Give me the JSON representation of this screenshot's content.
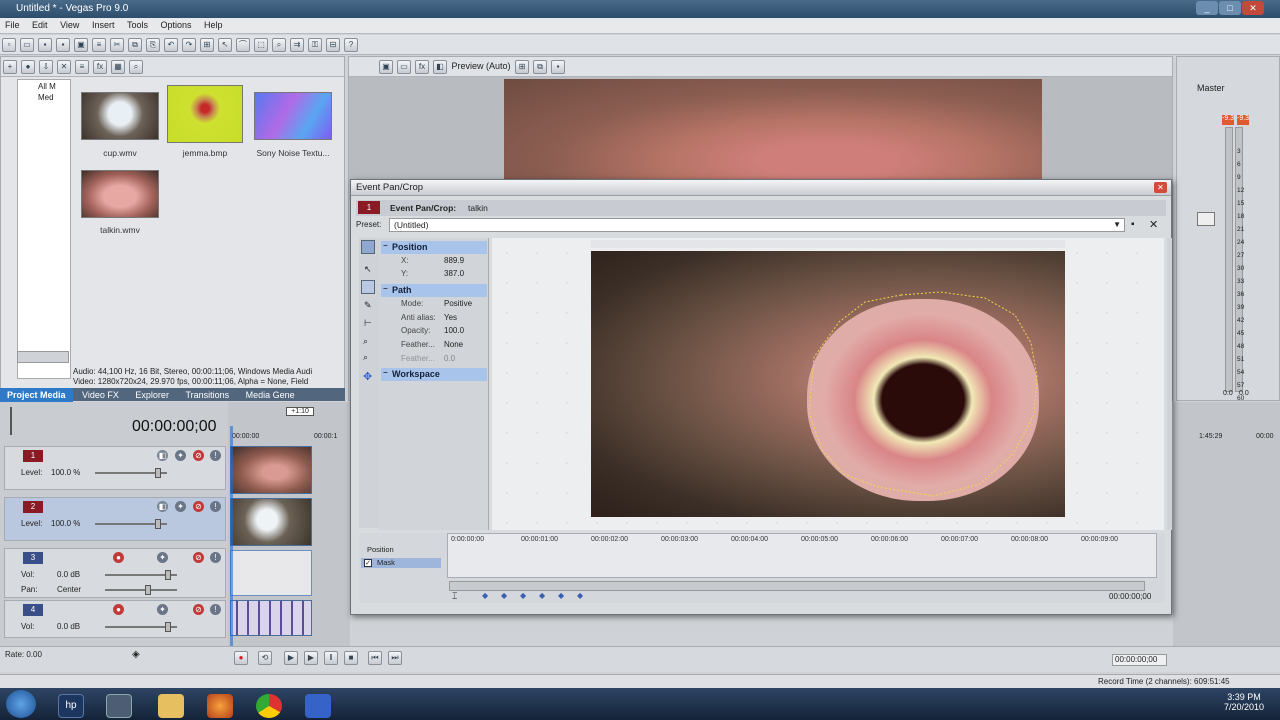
{
  "window": {
    "title": "Untitled * - Vegas Pro 9.0"
  },
  "menu": [
    "File",
    "Edit",
    "View",
    "Insert",
    "Tools",
    "Options",
    "Help"
  ],
  "project_media": {
    "tree": [
      "All M",
      "Med"
    ],
    "items": [
      {
        "label": "cup.wmv"
      },
      {
        "label": "jemma.bmp"
      },
      {
        "label": "Sony Noise Textu..."
      },
      {
        "label": "talkin.wmv"
      }
    ],
    "info_line1": "Audio: 44,100 Hz, 16 Bit, Stereo, 00:00:11;06, Windows Media Audi",
    "info_line2": "Video: 1280x720x24, 29.970 fps, 00:00:11;06, Alpha = None, Field"
  },
  "tabs": [
    "Project Media",
    "Video FX",
    "Explorer",
    "Transitions",
    "Media Gene"
  ],
  "preview": {
    "mode": "Preview (Auto)"
  },
  "mixer": {
    "label": "Master",
    "peak_left": "-9.3",
    "peak_right": "-9.3",
    "scale": [
      "3",
      "6",
      "9",
      "12",
      "15",
      "18",
      "21",
      "24",
      "27",
      "30",
      "33",
      "36",
      "39",
      "42",
      "45",
      "48",
      "51",
      "54",
      "57",
      "60"
    ],
    "bottom_left": "0.0",
    "bottom_right": "0.0"
  },
  "timeline": {
    "timecode": "00:00:00;00",
    "marker": "+1:10",
    "ruler_start": "00:00:00",
    "ruler_next": "00:00:1",
    "rate": "Rate: 0.00",
    "right_time": "1:45:29",
    "right_end": "00:00",
    "transport_time": "00:00:00;00"
  },
  "tracks": [
    {
      "num": "1",
      "kind": "video",
      "level_label": "Level:",
      "level": "100.0 %"
    },
    {
      "num": "2",
      "kind": "video",
      "level_label": "Level:",
      "level": "100.0 %"
    },
    {
      "num": "3",
      "kind": "audio",
      "vol_label": "Vol:",
      "vol": "0.0 dB",
      "pan_label": "Pan:",
      "pan": "Center"
    },
    {
      "num": "4",
      "kind": "audio",
      "vol_label": "Vol:",
      "vol": "0.0 dB"
    }
  ],
  "epc": {
    "title": "Event Pan/Crop",
    "header_bold": "Event Pan/Crop:",
    "header_clip": "talkin",
    "preset_label": "Preset:",
    "preset_value": "(Untitled)",
    "sections": {
      "position": "Position",
      "path": "Path",
      "workspace": "Workspace"
    },
    "position": [
      {
        "k": "X:",
        "v": "889.9"
      },
      {
        "k": "Y:",
        "v": "387.0"
      }
    ],
    "path": [
      {
        "k": "Mode:",
        "v": "Positive"
      },
      {
        "k": "Anti alias:",
        "v": "Yes"
      },
      {
        "k": "Opacity:",
        "v": "100.0"
      },
      {
        "k": "Feather...",
        "v": "None"
      },
      {
        "k": "Feather...",
        "v": "0.0"
      }
    ],
    "ruler": [
      "0:00:00:00",
      "00:00:01:00",
      "00:00:02:00",
      "00:00:03:00",
      "00:00:04:00",
      "00:00:05:00",
      "00:00:06:00",
      "00:00:07:00",
      "00:00:08:00",
      "00:00:09:00"
    ],
    "track_position": "Position",
    "track_mask": "Mask",
    "timecode": "00:00:00;00"
  },
  "status": {
    "record_time": "Record Time (2 channels): 609:51:45"
  },
  "taskbar": {
    "time": "3:39 PM",
    "date": "7/20/2010"
  },
  "colors": {
    "titlebar": "#2d4d6d",
    "dialog_bg": "#d9dcdf",
    "section_header": "#a9c4ea",
    "mask_path": "#f2d64b",
    "taskbar": "#1a2b42"
  }
}
